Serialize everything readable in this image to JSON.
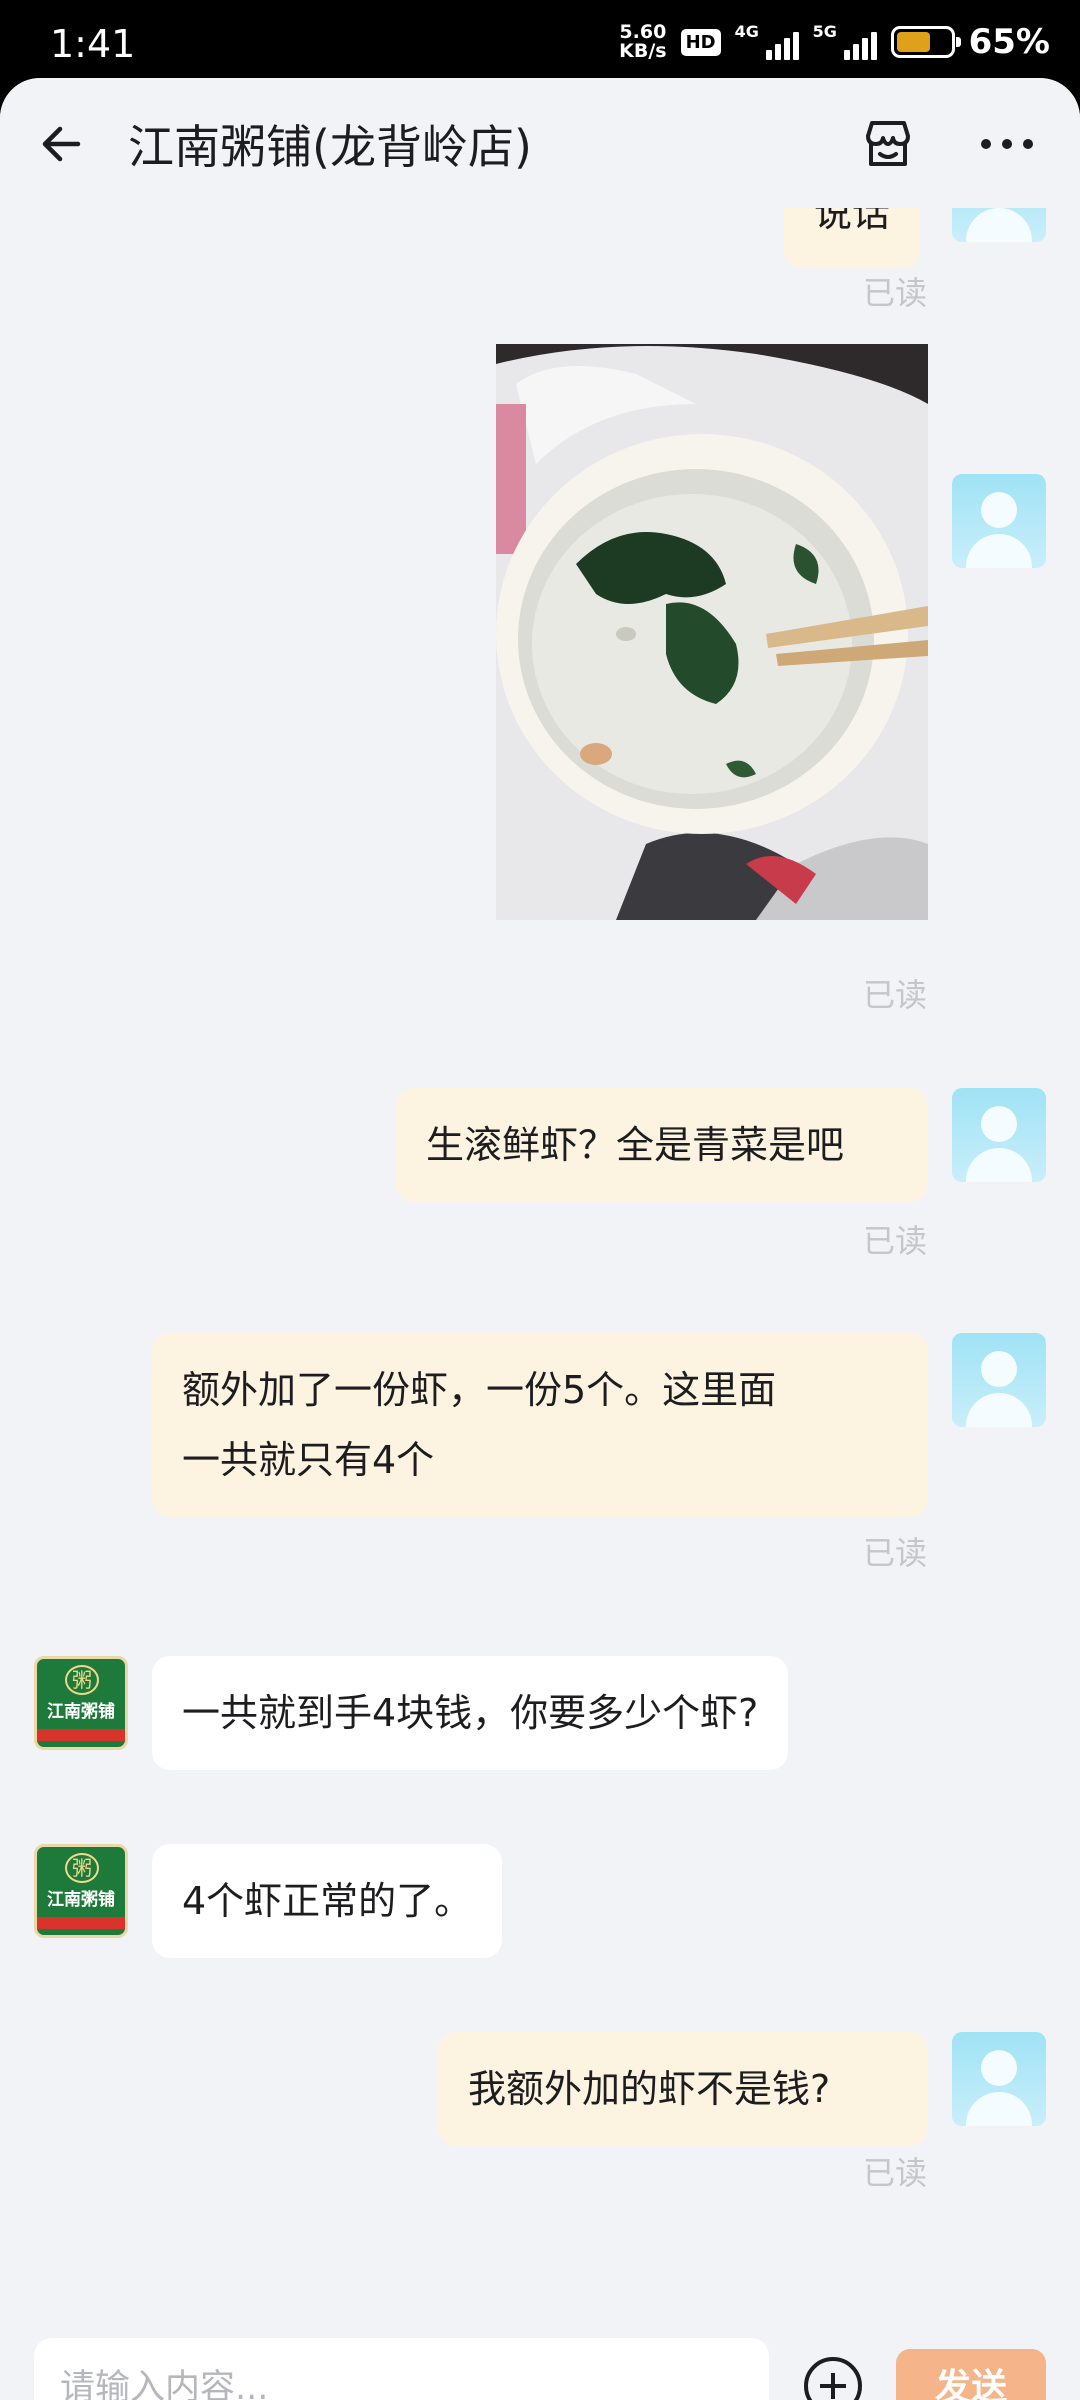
{
  "status_bar": {
    "time": "1:41",
    "speed_value": "5.60",
    "speed_unit": "KB/s",
    "hd": "HD",
    "net1": "4G",
    "net2": "5G",
    "battery_level": 0.65,
    "battery_pct": "65%",
    "battery_color": "#e0a11a"
  },
  "header": {
    "title": "江南粥铺(龙背岭店)",
    "back_icon": "arrow-left-icon",
    "shop_icon": "store-icon",
    "more_icon": "more-horizontal-icon"
  },
  "messages": [
    {
      "side": "out",
      "type": "text",
      "text": "说话",
      "status": "已读"
    },
    {
      "side": "out",
      "type": "image",
      "image_desc": "porridge-photo",
      "status": "已读"
    },
    {
      "side": "out",
      "type": "text",
      "text": "生滚鲜虾？全是青菜是吧",
      "status": "已读"
    },
    {
      "side": "out",
      "type": "text",
      "lines": [
        "额外加了一份虾，一份5个。这里面",
        "一共就只有4个"
      ],
      "status": "已读"
    },
    {
      "side": "in",
      "type": "text",
      "text": "一共就到手4块钱，你要多少个虾?",
      "avatar": {
        "name": "江南粥铺",
        "logo_char": "粥"
      }
    },
    {
      "side": "in",
      "type": "text",
      "text": "4个虾正常的了。",
      "avatar": {
        "name": "江南粥铺",
        "logo_char": "粥"
      }
    },
    {
      "side": "out",
      "type": "text",
      "text": "我额外加的虾不是钱?",
      "status": "已读"
    }
  ],
  "input": {
    "placeholder": "请输入内容...",
    "value": "",
    "add_icon": "plus-circle-icon",
    "send_label": "发送",
    "send_color": "#f5b48a"
  },
  "colors": {
    "background": "#f2f3f7",
    "bubble_out": "#fdf3e1",
    "bubble_in": "#ffffff",
    "read_text": "#c4c6cc"
  }
}
